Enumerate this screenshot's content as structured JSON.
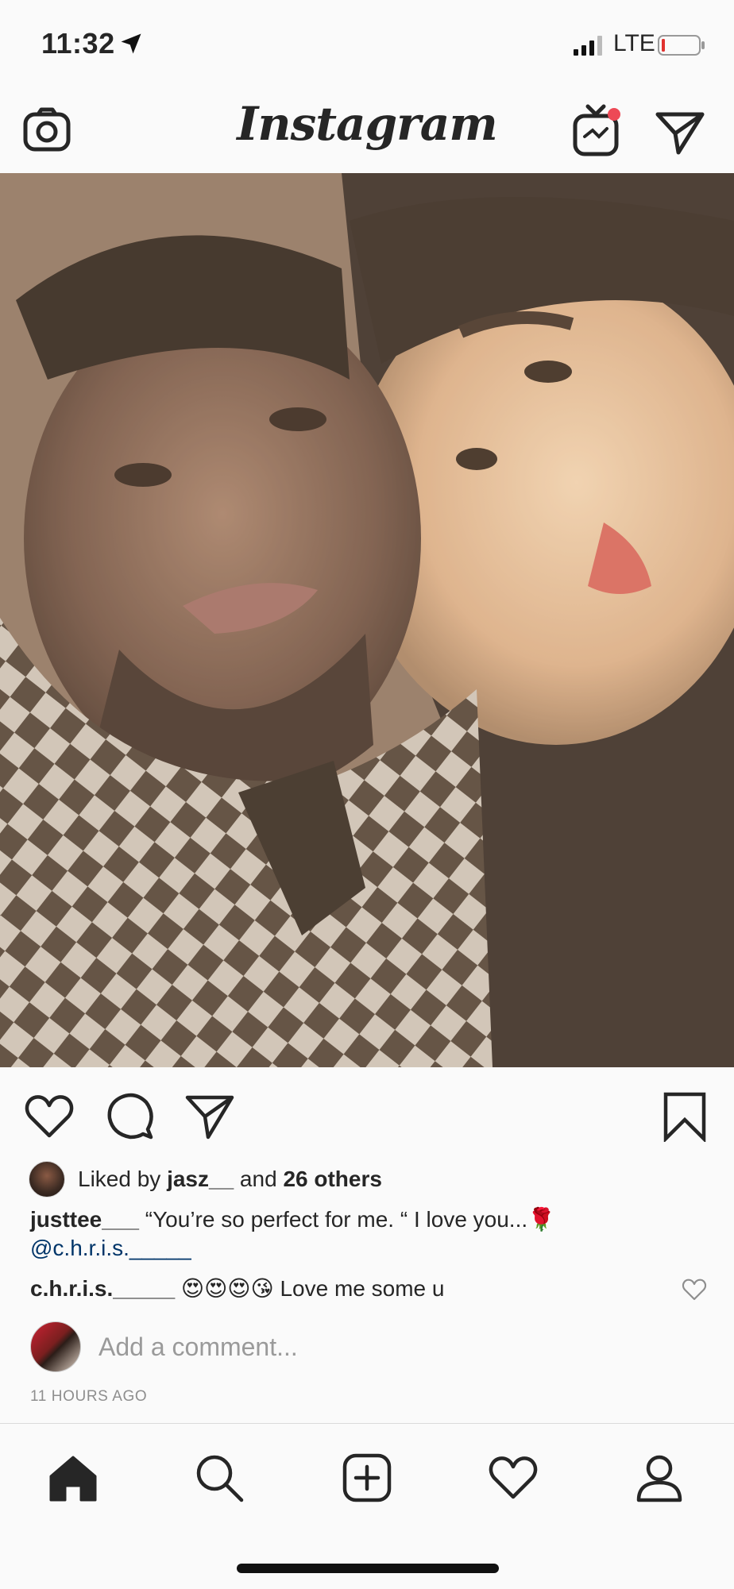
{
  "status_bar": {
    "time": "11:32",
    "network": "LTE"
  },
  "header": {
    "logo": "Instagram"
  },
  "post": {
    "liked_by_prefix": "Liked by ",
    "liked_by_user": "jasz__",
    "liked_by_and": " and ",
    "liked_by_others": "26 others",
    "caption_user": "justtee___",
    "caption_text": " “You’re so perfect for me. “ I love you...🌹",
    "caption_mention": "@c.h.r.i.s._____",
    "comment_user": "c.h.r.i.s._____",
    "comment_text": " 😍😍😍😘 Love me some u",
    "add_comment_placeholder": "Add a comment...",
    "timestamp": "11 HOURS AGO"
  },
  "icons": {
    "header": [
      "camera-icon",
      "igtv-icon",
      "direct-message-icon"
    ],
    "actions": [
      "heart-icon",
      "comment-icon",
      "share-icon",
      "bookmark-icon"
    ],
    "tabbar": [
      "home-icon",
      "search-icon",
      "add-post-icon",
      "activity-heart-icon",
      "profile-icon"
    ]
  },
  "colors": {
    "notification_dot": "#ed4956",
    "mention": "#003569",
    "muted": "#8e8e8e"
  }
}
